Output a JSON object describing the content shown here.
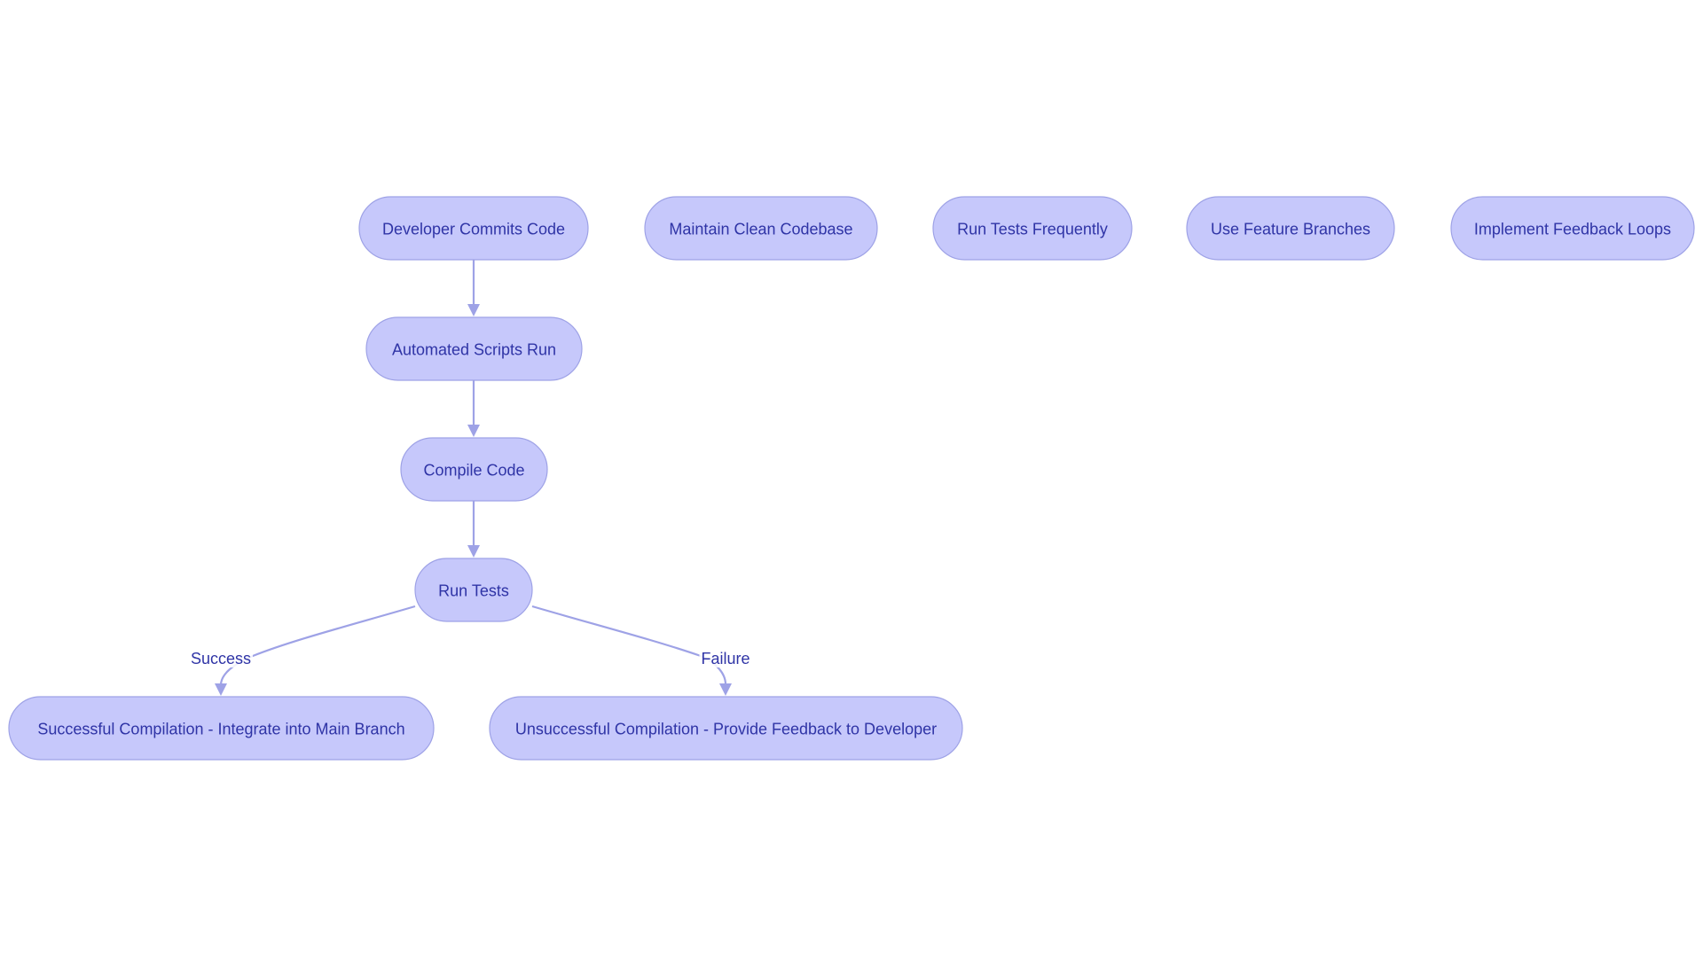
{
  "diagram": {
    "type": "flowchart",
    "colors": {
      "node_fill": "#c6c8fb",
      "node_border": "#9ea2e6",
      "text": "#2f34a6",
      "edge": "#9ea2e6"
    },
    "nodes": [
      {
        "id": "commit",
        "label": "Developer Commits Code"
      },
      {
        "id": "scripts",
        "label": "Automated Scripts Run"
      },
      {
        "id": "compile",
        "label": "Compile Code"
      },
      {
        "id": "tests",
        "label": "Run Tests"
      },
      {
        "id": "success",
        "label": "Successful Compilation - Integrate into Main Branch"
      },
      {
        "id": "failure",
        "label": "Unsuccessful Compilation - Provide Feedback to Developer"
      },
      {
        "id": "clean",
        "label": "Maintain Clean Codebase"
      },
      {
        "id": "frequent",
        "label": "Run Tests Frequently"
      },
      {
        "id": "branches",
        "label": "Use Feature Branches"
      },
      {
        "id": "feedback",
        "label": "Implement Feedback Loops"
      }
    ],
    "edges": [
      {
        "from": "commit",
        "to": "scripts",
        "label": ""
      },
      {
        "from": "scripts",
        "to": "compile",
        "label": ""
      },
      {
        "from": "compile",
        "to": "tests",
        "label": ""
      },
      {
        "from": "tests",
        "to": "success",
        "label": "Success"
      },
      {
        "from": "tests",
        "to": "failure",
        "label": "Failure"
      }
    ]
  }
}
